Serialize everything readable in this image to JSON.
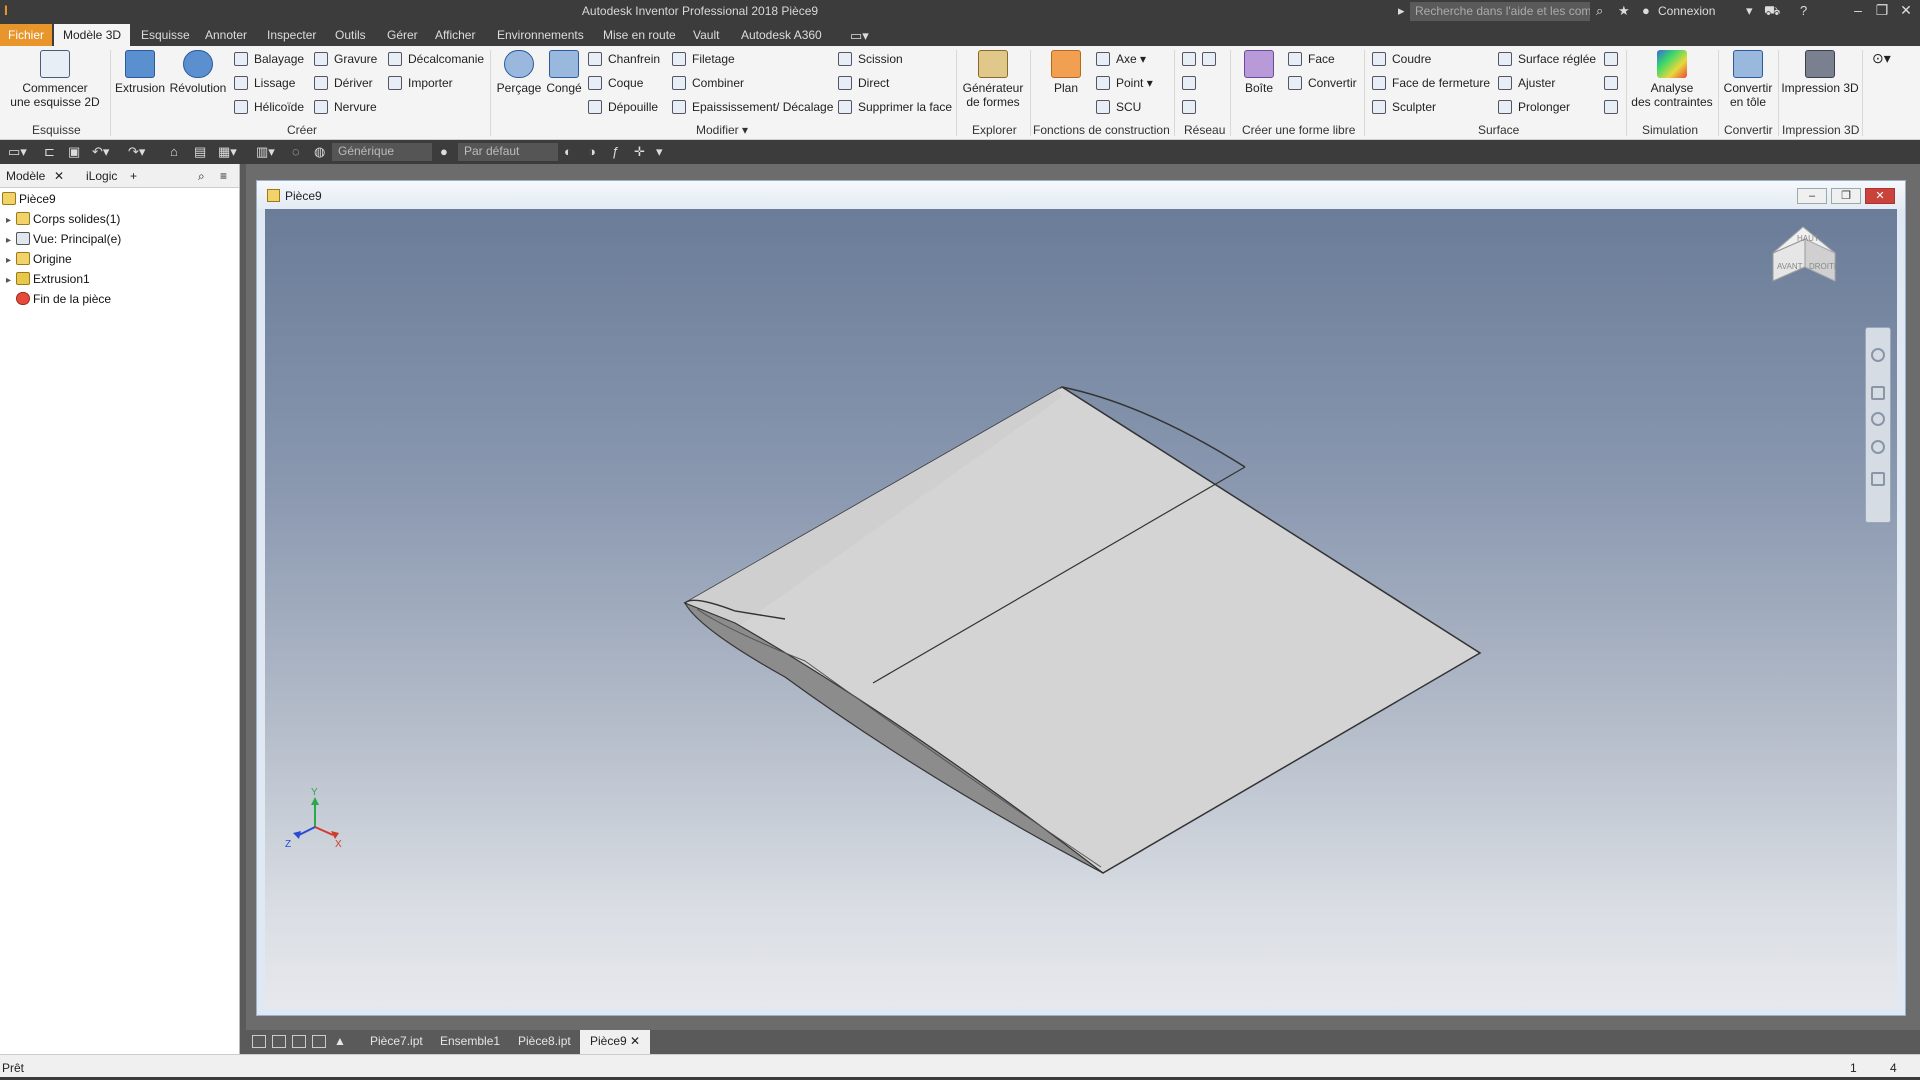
{
  "app": {
    "title": "Autodesk Inventor Professional 2018    Pièce9",
    "logo": "I",
    "search_placeholder": "Recherche dans l'aide et les com",
    "user": "Connexion"
  },
  "menu": {
    "items": [
      "Fichier",
      "Modèle 3D",
      "Esquisse",
      "Annoter",
      "Inspecter",
      "Outils",
      "Gérer",
      "Afficher",
      "Environnements",
      "Mise en route",
      "Vault",
      "Autodesk A360"
    ],
    "active": "Modèle 3D"
  },
  "ribbon": {
    "esquisse_panel": {
      "start_sketch": "Commencer",
      "start_sketch_2": "une esquisse 2D",
      "label": "Esquisse"
    },
    "creer_panel": {
      "extrusion": "Extrusion",
      "revolution": "Révolution",
      "balayage": "Balayage",
      "lissage": "Lissage",
      "helicoide": "Hélicoïde",
      "gravure": "Gravure",
      "deriver": "Dériver",
      "nervure": "Nervure",
      "decalcomanie": "Décalcomanie",
      "importer": "Importer",
      "label": "Créer"
    },
    "modifier_panel": {
      "percage": "Perçage",
      "conge": "Congé",
      "chanfrein": "Chanfrein",
      "coque": "Coque",
      "depouille": "Dépouille",
      "filetage": "Filetage",
      "combiner": "Combiner",
      "epaississement": "Epaississement/ Décalage",
      "scission": "Scission",
      "direct": "Direct",
      "supprimer_face": "Supprimer la face",
      "label": "Modifier"
    },
    "explorer_panel": {
      "generator": "Générateur",
      "generator_2": "de formes",
      "label": "Explorer"
    },
    "construction_panel": {
      "plan": "Plan",
      "axe": "Axe",
      "point": "Point",
      "scu": "SCU",
      "label": "Fonctions de construction"
    },
    "reseau_panel": {
      "label": "Réseau"
    },
    "freeform_panel": {
      "boite": "Boîte",
      "face": "Face",
      "convertir": "Convertir",
      "label": "Créer une forme libre"
    },
    "surface_panel": {
      "coudre": "Coudre",
      "face_fermeture": "Face de fermeture",
      "sculpter": "Sculpter",
      "surface_reglee": "Surface réglée",
      "ajuster": "Ajuster",
      "prolonger": "Prolonger",
      "label": "Surface"
    },
    "simulation_panel": {
      "analyse": "Analyse",
      "analyse_2": "des contraintes",
      "label": "Simulation"
    },
    "convertir_panel": {
      "convertir": "Convertir",
      "convertir_2": "en tôle",
      "label": "Convertir"
    },
    "impression_panel": {
      "impression": "Impression 3D",
      "label": "Impression 3D"
    }
  },
  "qat": {
    "material": "Générique",
    "appearance": "Par défaut"
  },
  "browser": {
    "tabs": [
      "Modèle",
      "iLogic"
    ],
    "items": [
      "Pièce9",
      "Corps solides(1)",
      "Vue: Principal(e)",
      "Origine",
      "Extrusion1",
      "Fin de la pièce"
    ]
  },
  "document": {
    "title": "Pièce9",
    "viewcube_top": "HAUT",
    "viewcube_front": "AVANT",
    "viewcube_right": "DROITE"
  },
  "axes": {
    "y": "Y",
    "x": "X",
    "z": "Z",
    "colors": {
      "x": "#d23a2a",
      "y": "#2aa84a",
      "z": "#2a4ad2"
    }
  },
  "doc_tabs": [
    "Pièce7.ipt",
    "Ensemble1",
    "Pièce8.ipt",
    "Pièce9"
  ],
  "status": {
    "text": "Prêt",
    "n1": "1",
    "n2": "4"
  },
  "colors": {
    "accent": "#e8952c",
    "dark": "#3c3c3c",
    "ribbon": "#f4f4f4"
  }
}
